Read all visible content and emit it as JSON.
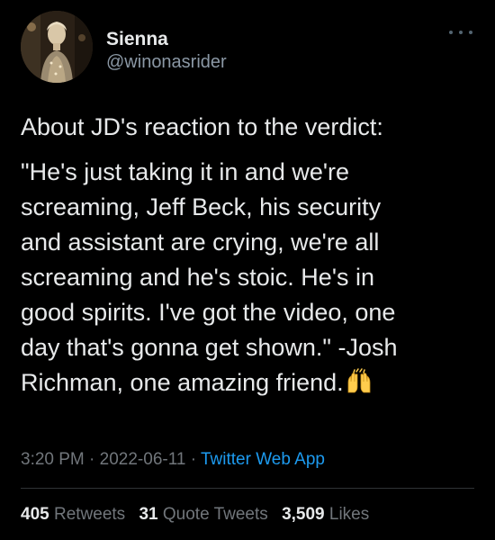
{
  "user": {
    "display_name": "Sienna",
    "handle": "@winonasrider"
  },
  "tweet": {
    "intro": "About JD's reaction to the verdict:",
    "quote_lines": [
      "\"He's just taking it in and we're",
      "screaming, Jeff Beck, his security",
      "and assistant are crying, we're all",
      "screaming and he's stoic. He's in",
      "good spirits. I've got the video, one",
      "day that's gonna get shown.\" -Josh",
      "Richman, one amazing friend."
    ],
    "emoji": "raising-hands-emoji"
  },
  "meta": {
    "time": "3:20 PM",
    "sep1": " · ",
    "date": "2022-06-11",
    "sep2": " · ",
    "app": "Twitter Web App"
  },
  "stats": {
    "retweets_count": "405",
    "retweets_label": "Retweets",
    "quote_count": "31",
    "quote_label": "Quote Tweets",
    "likes_count": "3,509",
    "likes_label": "Likes"
  },
  "icons": {
    "more": "more-horizontal-icon"
  },
  "colors": {
    "background": "#000000",
    "text": "#e7e9ea",
    "secondary": "#71767b",
    "link": "#1d9bf0",
    "divider": "#2f3336"
  }
}
